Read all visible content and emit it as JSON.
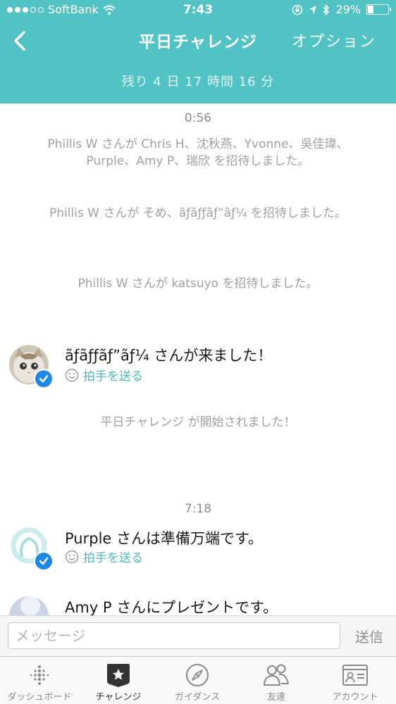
{
  "status_bar": {
    "carrier": "SoftBank",
    "time": "7:43",
    "battery": "29%",
    "battery_level": 0.29
  },
  "nav": {
    "title": "平日チャレンジ",
    "option_label": "オプション",
    "back_icon": "chevron-left-icon"
  },
  "remaining": "残り 4 日 17 時間 16 分",
  "feed": {
    "time_1": "0:56",
    "sys_1": "Phillis W さんが Chris H、沈秋燕、Yvonne、吳佳瑋、Purple、Amy P、瑞欣 を招待しました。",
    "sys_2": "Phillis W さんが そめ、ãƒãƒƒãƒ”ãƒ¼ を招待しました。",
    "sys_3": "Phillis W さんが katsuyo を招待しました。",
    "join_msg": "ãƒãƒƒãƒ”ãƒ¼ さんが来ました！",
    "cheer_1": "拍手を送る",
    "sys_4": "平日チャレンジ が開始されました！",
    "time_2": "7:18",
    "purple_msg": "Purple さんは準備万端です。",
    "cheer_2": "拍手を送る",
    "amy_msg": "Amy P さんにプレゼントです。"
  },
  "composer": {
    "placeholder": "メッセージ",
    "send_label": "送信"
  },
  "tabs": [
    {
      "label": "ダッシュボード",
      "icon": "dashboard-dots-icon"
    },
    {
      "label": "チャレンジ",
      "icon": "challenge-star-icon"
    },
    {
      "label": "ガイダンス",
      "icon": "compass-icon"
    },
    {
      "label": "友達",
      "icon": "friends-icon"
    },
    {
      "label": "アカウント",
      "icon": "account-card-icon"
    }
  ],
  "colors": {
    "header": "#52C3C4",
    "accent": "#4BB9BE",
    "check": "#1E88E5"
  }
}
